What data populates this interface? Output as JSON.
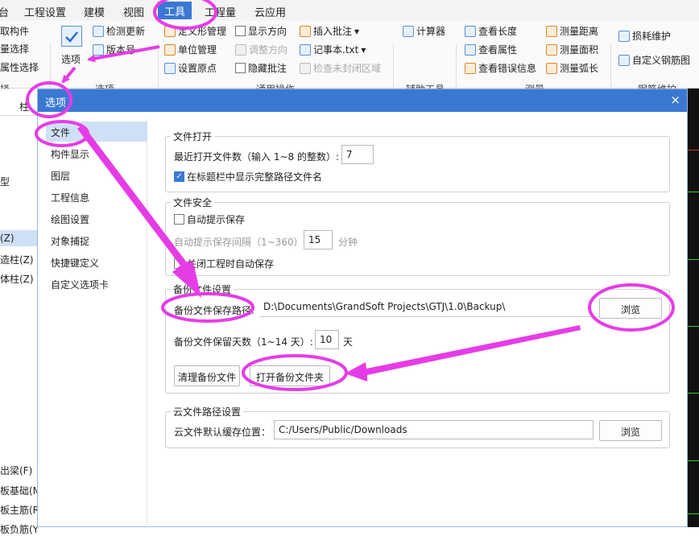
{
  "menubar": {
    "items": [
      {
        "label": "台"
      },
      {
        "label": "工程设置"
      },
      {
        "label": "建模"
      },
      {
        "label": "视图"
      },
      {
        "label": "工具",
        "active": true
      },
      {
        "label": "工程量"
      },
      {
        "label": "云应用"
      }
    ]
  },
  "ribbon": {
    "left_items": [
      "取构件",
      "量选择",
      "属性选择"
    ],
    "options_label": "选项",
    "check_update": "检测更新",
    "version": "版本号",
    "group_label_options": "选项",
    "custom_shape": "定义形管理",
    "unit_manage": "单位管理",
    "set_origin": "设置原点",
    "show_direction": "显示方向",
    "adjust_direction": "调整方向",
    "hide_annotation": "隐藏批注",
    "insert_annotation": "插入批注",
    "notepad": "记事本.txt",
    "check_unclosed": "检查未封闭区域",
    "group_label_general": "通用操作",
    "calculator": "计算器",
    "group_label_aux": "辅助工具",
    "view_length": "查看长度",
    "view_attribute": "查看属性",
    "view_error": "查看错误信息",
    "measure_distance": "测量距离",
    "measure_area": "测量面积",
    "measure_arc": "测量弧长",
    "group_label_measure": "测量",
    "loss_maintain": "损耗维护",
    "custom_rebar": "自定义钢筋图",
    "group_label_rebar": "钢筋维护",
    "left_group_label": "择"
  },
  "leftpanel": {
    "items": [
      "柱",
      "型",
      "(Z)",
      "造柱(Z)",
      "体柱(Z)",
      "出梁(F)",
      "板基础(M",
      "板主筋(R)",
      "板负筋(Y"
    ]
  },
  "dialog": {
    "title": "选项",
    "close": "×",
    "nav": [
      "文件",
      "构件显示",
      "图层",
      "工程信息",
      "绘图设置",
      "对象捕捉",
      "快捷键定义",
      "自定义选项卡"
    ],
    "file_open": {
      "title": "文件打开",
      "recent_label": "最近打开文件数（输入 1~8 的整数）:",
      "recent_value": "7",
      "show_full_path": "在标题栏中显示完整路径文件名",
      "show_full_path_checked": true
    },
    "file_security": {
      "title": "文件安全",
      "auto_save": "自动提示保存",
      "interval_label": "自动提示保存间隔（1~360）",
      "interval_value": "15",
      "interval_unit": "分钟",
      "auto_save_on_close": "关闭工程时自动保存"
    },
    "backup": {
      "title": "备份文件设置",
      "path_label": "备份文件保存路径:",
      "path_value": "D:\\Documents\\GrandSoft Projects\\GTJ\\1.0\\Backup\\",
      "browse": "浏览",
      "keep_days_label": "备份文件保留天数（1~14 天）:",
      "keep_days_value": "10",
      "keep_days_unit": "天",
      "clear_backup": "清理备份文件",
      "open_backup_folder": "打开备份文件夹"
    },
    "cloud": {
      "title": "云文件路径设置",
      "cache_label": "云文件默认缓存位置：",
      "cache_value": "C:/Users/Public/Downloads",
      "browse": "浏览"
    }
  },
  "colors": {
    "accent": "#3a78d4",
    "annotation": "#e63ce6"
  }
}
